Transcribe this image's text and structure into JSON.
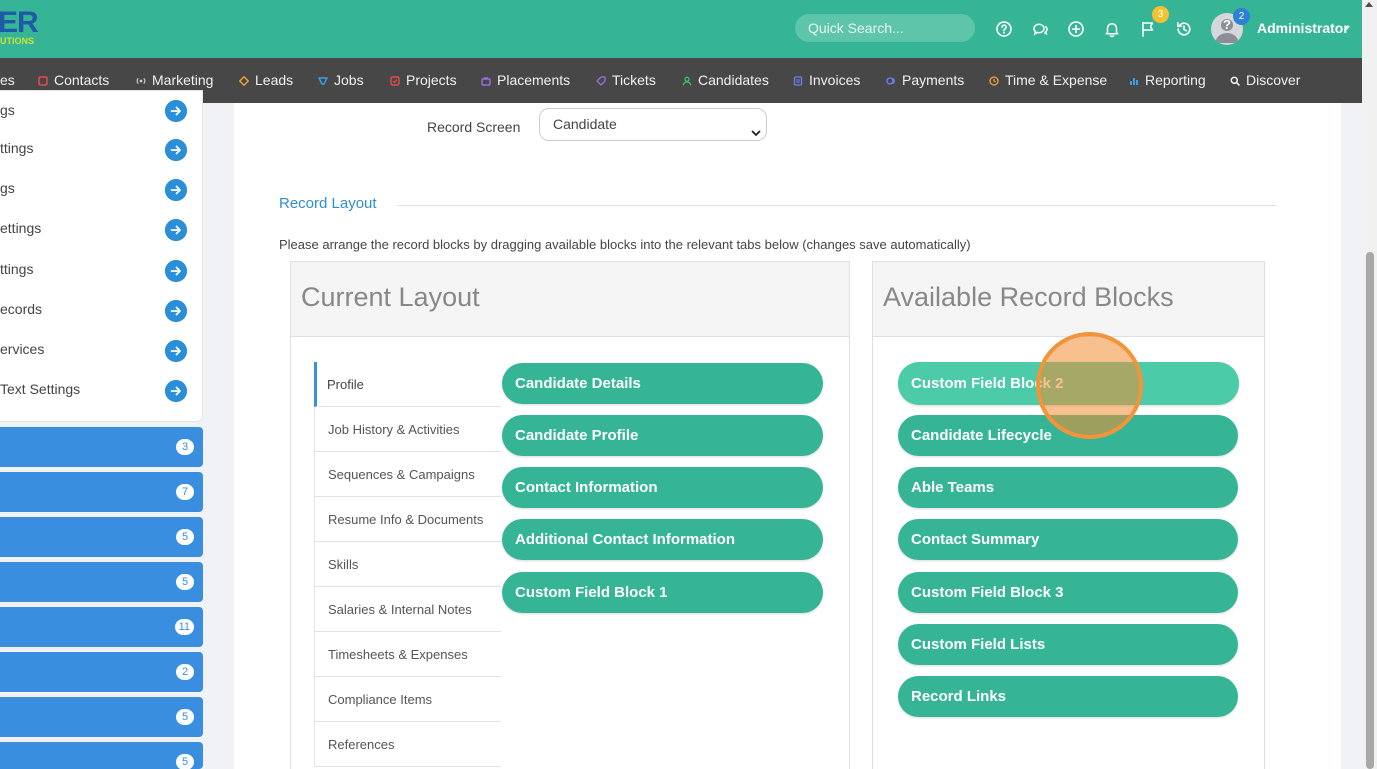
{
  "header": {
    "logo_text": "ER",
    "logo_subtext": "UTIONS",
    "search_placeholder": "Quick Search...",
    "flag_count": "3",
    "avatar_count": "2",
    "user_name": "Administrator"
  },
  "nav": {
    "items": [
      {
        "label": "es"
      },
      {
        "label": "Contacts",
        "color": "#e34b4b"
      },
      {
        "label": "Marketing",
        "color": "#cccccc"
      },
      {
        "label": "Leads",
        "color": "#f0a23a"
      },
      {
        "label": "Jobs",
        "color": "#3aa0e8"
      },
      {
        "label": "Projects",
        "color": "#e34b4b"
      },
      {
        "label": "Placements",
        "color": "#9b6ee0"
      },
      {
        "label": "Tickets",
        "color": "#9b6ee0"
      },
      {
        "label": "Candidates",
        "color": "#3cc06a"
      },
      {
        "label": "Invoices",
        "color": "#6b7ff0"
      },
      {
        "label": "Payments",
        "color": "#6b7ff0"
      },
      {
        "label": "Time & Expense",
        "color": "#f0a23a"
      },
      {
        "label": "Reporting",
        "color": "#3aa0e8"
      },
      {
        "label": "Discover",
        "color": "#ffffff"
      }
    ]
  },
  "sidebar": {
    "settings": [
      {
        "label": "gs"
      },
      {
        "label": "ttings"
      },
      {
        "label": "gs"
      },
      {
        "label": "ettings"
      },
      {
        "label": "ttings"
      },
      {
        "label": "ecords"
      },
      {
        "label": "ervices"
      },
      {
        "label": "Text Settings"
      }
    ],
    "counters": [
      {
        "count": "3"
      },
      {
        "count": "7"
      },
      {
        "count": "5"
      },
      {
        "count": "5"
      },
      {
        "count": "11"
      },
      {
        "count": "2"
      },
      {
        "count": "5"
      },
      {
        "count": "5"
      }
    ]
  },
  "record_screen": {
    "label": "Record Screen",
    "selected": "Candidate"
  },
  "record_layout": {
    "title": "Record Layout",
    "instructions": "Please arrange the record blocks by dragging available blocks into the relevant tabs below (changes save automatically)"
  },
  "current_layout": {
    "title": "Current Layout",
    "tabs": [
      {
        "label": "Profile"
      },
      {
        "label": "Job History & Activities"
      },
      {
        "label": "Sequences & Campaigns"
      },
      {
        "label": "Resume Info & Documents"
      },
      {
        "label": "Skills"
      },
      {
        "label": "Salaries & Internal Notes"
      },
      {
        "label": "Timesheets & Expenses"
      },
      {
        "label": "Compliance Items"
      },
      {
        "label": "References"
      }
    ],
    "blocks": [
      {
        "label": "Candidate Details"
      },
      {
        "label": "Candidate Profile"
      },
      {
        "label": "Contact Information"
      },
      {
        "label": "Additional Contact Information"
      },
      {
        "label": "Custom Field Block 1"
      }
    ]
  },
  "available_blocks": {
    "title": "Available Record Blocks",
    "blocks": [
      {
        "label": "Custom Field Block 2"
      },
      {
        "label": "Candidate Lifecycle"
      },
      {
        "label": "Able Teams"
      },
      {
        "label": "Contact Summary"
      },
      {
        "label": "Custom Field Block 3"
      },
      {
        "label": "Custom Field Lists"
      },
      {
        "label": "Record Links"
      }
    ]
  },
  "colors": {
    "topbar": "#36b596",
    "navbar": "#474747",
    "block": "#36b596",
    "accent_blue": "#3a8ee0",
    "click_marker": "#f2943a"
  }
}
